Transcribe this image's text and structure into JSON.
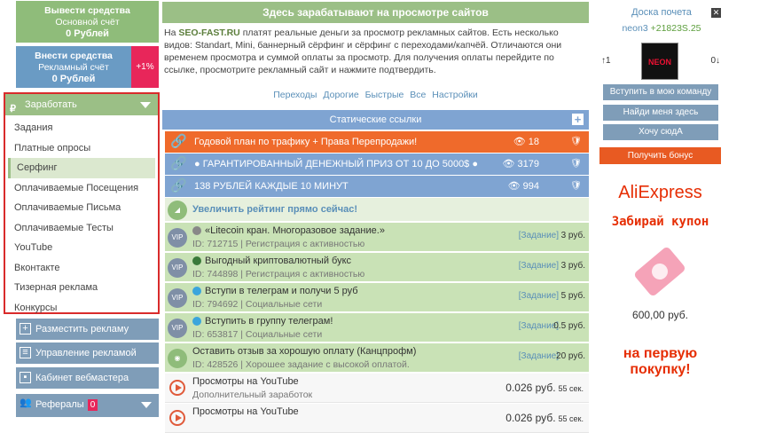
{
  "balance": {
    "out_title": "Вывести средства",
    "out_sub": "Основной счёт",
    "out_val": "0 Рублей",
    "ad_title": "Внести средства",
    "ad_sub": "Рекламный счёт",
    "ad_val": "0 Рублей",
    "bonus_pct": "+1%"
  },
  "earn": {
    "label": "Заработать",
    "items": [
      "Задания",
      "Платные опросы",
      "Серфинг",
      "Оплачиваемые Посещения",
      "Оплачиваемые Письма",
      "Оплачиваемые Тесты",
      "YouTube",
      "Вконтакте",
      "Тизерная реклама",
      "Конкурсы"
    ]
  },
  "menu": {
    "place_ad": "Разместить рекламу",
    "manage_ad": "Управление рекламой",
    "webmaster": "Кабинет вебмастера",
    "referrals": "Рефералы",
    "ref_count": "0"
  },
  "main": {
    "title": "Здесь зарабатывают на просмотре сайтов",
    "intro_pre": "На ",
    "site": "SEO-FAST.RU",
    "intro_post": "   платят реальные деньги за просмотр рекламных сайтов. Есть несколько видов: Standart, Mini, баннерный сёрфинг и сёрфинг с переходами/капчёй. Отличаются они временем просмотра и суммой оплаты за просмотр. Для получения оплаты перейдите по ссылке, просмотрите рекламный сайт и нажмите подтвердить.",
    "tabs": [
      "Переходы",
      "Дорогие",
      "Быстрые",
      "Все",
      "Настройки"
    ],
    "static_links": "Статические ссылки",
    "rows": [
      {
        "text": "Годовой план по трафику + Права Перепродажи!",
        "views": "18",
        "color": "#ef6a2b"
      },
      {
        "text": "● ГАРАНТИРОВАННЫЙ ДЕНЕЖНЫЙ ПРИЗ ОТ 10 ДО 5000$ ●",
        "views": "3179",
        "color": "#7fa4d2"
      },
      {
        "text": "138 РУБЛЕЙ КАЖДЫЕ 10 МИНУТ",
        "views": "994",
        "color": "#7fa4d2"
      }
    ],
    "boost": "Увеличить рейтинг прямо сейчас!",
    "tasks": [
      {
        "title": "«Litecoin кран. Многоразовое задание.»",
        "meta": "ID: 712715 | Регистрация с активностью",
        "link": "[Задание]",
        "price": "3 руб."
      },
      {
        "title": "Выгодный криптовалютный букс",
        "meta": "ID: 744898 | Регистрация с активностью",
        "link": "[Задание]",
        "price": "3 руб."
      },
      {
        "title": "Вступи в телеграм и получи 5 руб",
        "meta": "ID: 794692 | Социальные сети",
        "link": "[Задание]",
        "price": "5 руб."
      },
      {
        "title": "Вступить в группу телеграм!",
        "meta": "ID: 653817 | Социальные сети",
        "link": "[Задание]",
        "price": "0.5 руб."
      },
      {
        "title": "Оставить отзыв за хорошую оплату (Канцпрофм)",
        "meta": "ID: 428526 | Хорошее задание с высокой оплатой.",
        "link": "[Задание]",
        "price": "20 руб."
      }
    ],
    "views": [
      {
        "title": "Просмотры на YouTube",
        "sub": "Дополнительный заработок",
        "price": "0.026 руб.",
        "time": "55 сек."
      },
      {
        "title": "Просмотры на YouTube",
        "sub": "",
        "price": "0.026 руб.",
        "time": "55 сек."
      }
    ]
  },
  "right": {
    "board": "Доска почета",
    "user": "neon3",
    "score": "+21823S.25",
    "up": "↑1",
    "down": "0↓",
    "avatar_text": "NEON",
    "btn1": "Вступить в мою команду",
    "btn2": "Найди меня здесь",
    "btn3": "Хочу сюдА",
    "bonus": "Получить бонус",
    "ali": "AliExpress",
    "coupon": "Забирай купон",
    "price": "600,00 руб.",
    "first": "на первую покупку!"
  }
}
